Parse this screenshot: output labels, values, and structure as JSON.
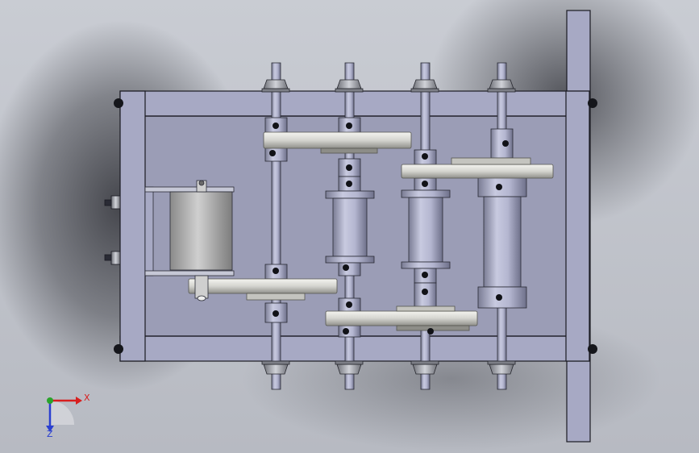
{
  "viewport": {
    "background_top": "#c9ccd3",
    "background_bottom": "#b7bac2",
    "shadow_color": "#2f3036"
  },
  "colors": {
    "frame": "#a7a9c4",
    "frame_edge": "#1a1a22",
    "panel": "#9b9db6",
    "shaft": "#a9abc6",
    "collar": "#a8aac6",
    "pulley": "#d6d6d2",
    "motor": "#b2b2b2",
    "nut": "#9fa1a8",
    "axis_x": "#d81e1e",
    "axis_y": "#2aa32a",
    "axis_z": "#2a3fd0"
  },
  "triad": {
    "x_label": "X",
    "z_label": "Z"
  }
}
